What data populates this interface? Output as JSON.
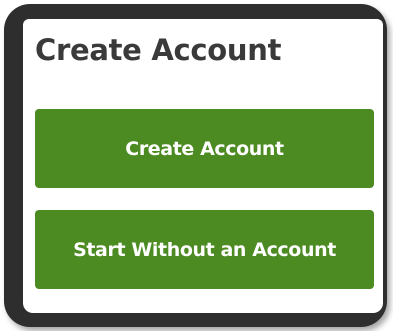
{
  "panel": {
    "title": "Create Account"
  },
  "buttons": {
    "create_account": "Create Account",
    "start_without_account": "Start Without an Account"
  },
  "colors": {
    "button_green": "#4c8a22",
    "frame": "#2e2e2e",
    "title_text": "#3a3a3a"
  }
}
